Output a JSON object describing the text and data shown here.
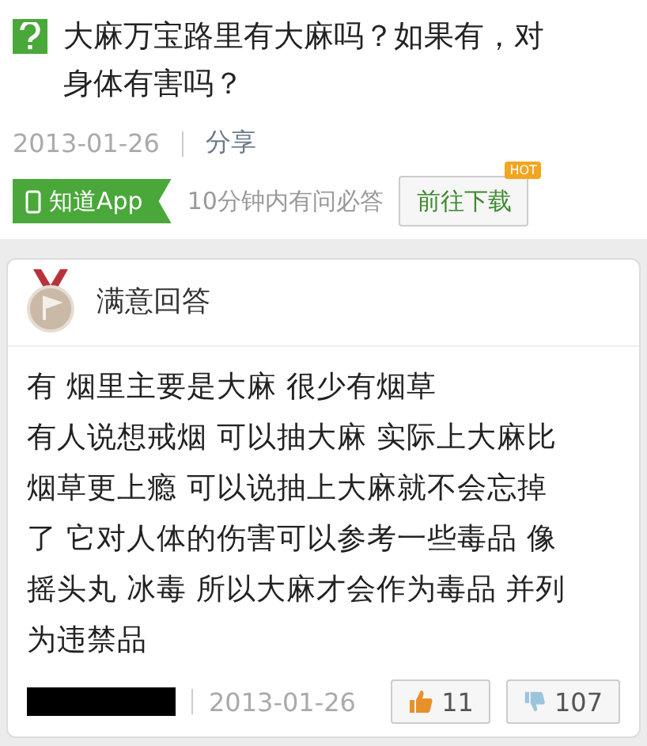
{
  "question": {
    "title": "大麻万宝路里有大麻吗？如果有，对身体有害吗？",
    "date": "2013-01-26",
    "share": "分享"
  },
  "app_promo": {
    "badge": "知道App",
    "slogan": "10分钟内有问必答",
    "download": "前往下载",
    "hot": "HOT"
  },
  "answer": {
    "header": "满意回答",
    "paragraphs": [
      "有 烟里主要是大麻 很少有烟草",
      "有人说想戒烟 可以抽大麻 实际上大麻比烟草更上瘾 可以说抽上大麻就不会忘掉了 它对人体的伤害可以参考一些毒品 像摇头丸 冰毒 所以大麻才会作为毒品 并列为违禁品"
    ],
    "date": "2013-01-26",
    "likes": "11",
    "dislikes": "107"
  }
}
